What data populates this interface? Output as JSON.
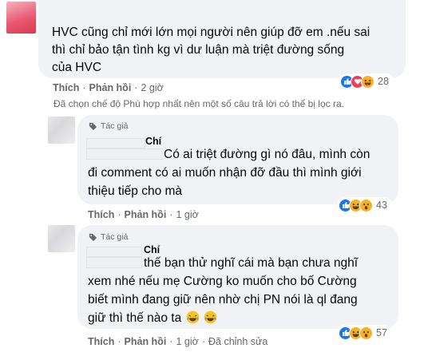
{
  "comments": [
    {
      "text_lines": [
        "HVC cũng chỉ mới lớn mọi người nên giúp đỡ em .nếu sai",
        "thì chỉ bảo tận tình kg vì dư luận mà triệt đường sống",
        "của HVC"
      ],
      "like_label": "Thích",
      "reply_label": "Phản hồi",
      "time": "2 giờ",
      "reactions": [
        "like",
        "love",
        "haha"
      ],
      "reaction_count": "28"
    },
    {
      "author_tag": "Tác giả",
      "author_name": "Chí",
      "text_lines": [
        "Có ai triệt đường gì nó đâu, mình còn",
        "đi comment có ai muốn nhận đỡ đầu thì mình giới",
        "thiệu tiếp cho mà"
      ],
      "like_label": "Thích",
      "reply_label": "Phản hồi",
      "time": "1 giờ",
      "reactions": [
        "like",
        "haha",
        "wow"
      ],
      "reaction_count": "43"
    },
    {
      "author_tag": "Tác giả",
      "author_name": "Chí",
      "text_lines": [
        "thế bạn thử nghĩ cái mà bạn chưa nghĩ",
        "xem nhé nếu mẹ Cường ko muốn cho bố Cường",
        "biết mình đang giữ nên nhờ chị PN nói là ql đang",
        "giữ thì thế nào ta"
      ],
      "like_label": "Thích",
      "reply_label": "Phản hồi",
      "time": "1 giờ",
      "edited_label": "Đã chỉnh sửa",
      "reactions": [
        "like",
        "haha",
        "wow"
      ],
      "reaction_count": "57"
    }
  ],
  "filter_notice": "Đã chọn chế độ Phù hợp nhất nên một số câu trả lời có thể bị lọc ra.",
  "icons": [
    "tag-icon",
    "like-reaction-icon",
    "love-reaction-icon",
    "haha-reaction-icon",
    "wow-reaction-icon",
    "crying-laughing-emoji-icon"
  ],
  "colors": {
    "bubble": "#f0f2f5",
    "meta_text": "#65676b",
    "like": "#1877f2",
    "love": "#f33e58",
    "haha": "#f7b125"
  }
}
